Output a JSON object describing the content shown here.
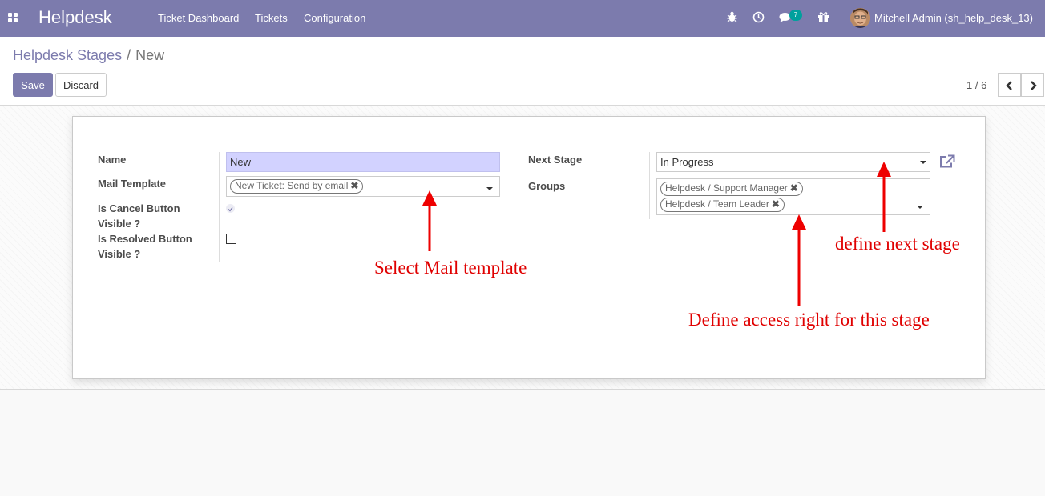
{
  "app": {
    "brand": "Helpdesk",
    "menu": [
      "Ticket Dashboard",
      "Tickets",
      "Configuration"
    ],
    "notification_count": "7",
    "user": "Mitchell Admin (sh_help_desk_13)",
    "icons": [
      "apps-grid-icon",
      "bug-icon",
      "clock-icon",
      "chat-icon",
      "gift-icon",
      "user-avatar"
    ]
  },
  "breadcrumb": {
    "parent": "Helpdesk Stages",
    "separator": "/",
    "current": "New"
  },
  "buttons": {
    "save": "Save",
    "discard": "Discard"
  },
  "pager": {
    "value": "1 / 6"
  },
  "form": {
    "name_label": "Name",
    "name_value": "New",
    "mail_template_label": "Mail Template",
    "mail_template_tag": "New Ticket: Send by email",
    "cancel_label_line1": "Is Cancel Button",
    "cancel_label_line2": "Visible ?",
    "cancel_checked": true,
    "resolved_label_line1": "Is Resolved Button",
    "resolved_label_line2": "Visible ?",
    "resolved_checked": false,
    "next_stage_label": "Next Stage",
    "next_stage_value": "In Progress",
    "groups_label": "Groups",
    "group_tags": [
      "Helpdesk / Support Manager",
      "Helpdesk / Team Leader"
    ]
  },
  "annotations": {
    "mail_template": "Select Mail template",
    "next_stage": "define next stage",
    "groups": "Define access right for this stage"
  },
  "colors": {
    "navbar": "#7c7bad",
    "primary": "#7c7bad",
    "name_field_bg": "#d2d2ff",
    "annotation": "#e00000",
    "badge": "#00a09d"
  }
}
